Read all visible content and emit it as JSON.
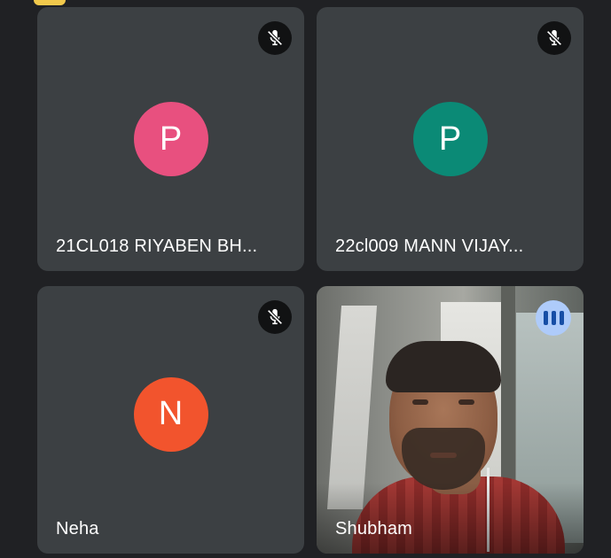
{
  "participants": [
    {
      "name": "21CL018 RIYABEN BH...",
      "initial": "P",
      "avatar_color": "#e8507f",
      "mic": "muted",
      "video": false
    },
    {
      "name": "22cl009 MANN VIJAY...",
      "initial": "P",
      "avatar_color": "#0b8a76",
      "mic": "muted",
      "video": false
    },
    {
      "name": "Neha",
      "initial": "N",
      "avatar_color": "#f2542d",
      "mic": "muted",
      "video": false
    },
    {
      "name": "Shubham",
      "initial": "",
      "mic": "speaking",
      "video": true
    }
  ],
  "icons": {
    "muted": "mic-off-icon",
    "speaking": "audio-level-icon"
  },
  "colors": {
    "background": "#202124",
    "tile": "#3c4043",
    "speaking_badge": "#aecbfa"
  }
}
